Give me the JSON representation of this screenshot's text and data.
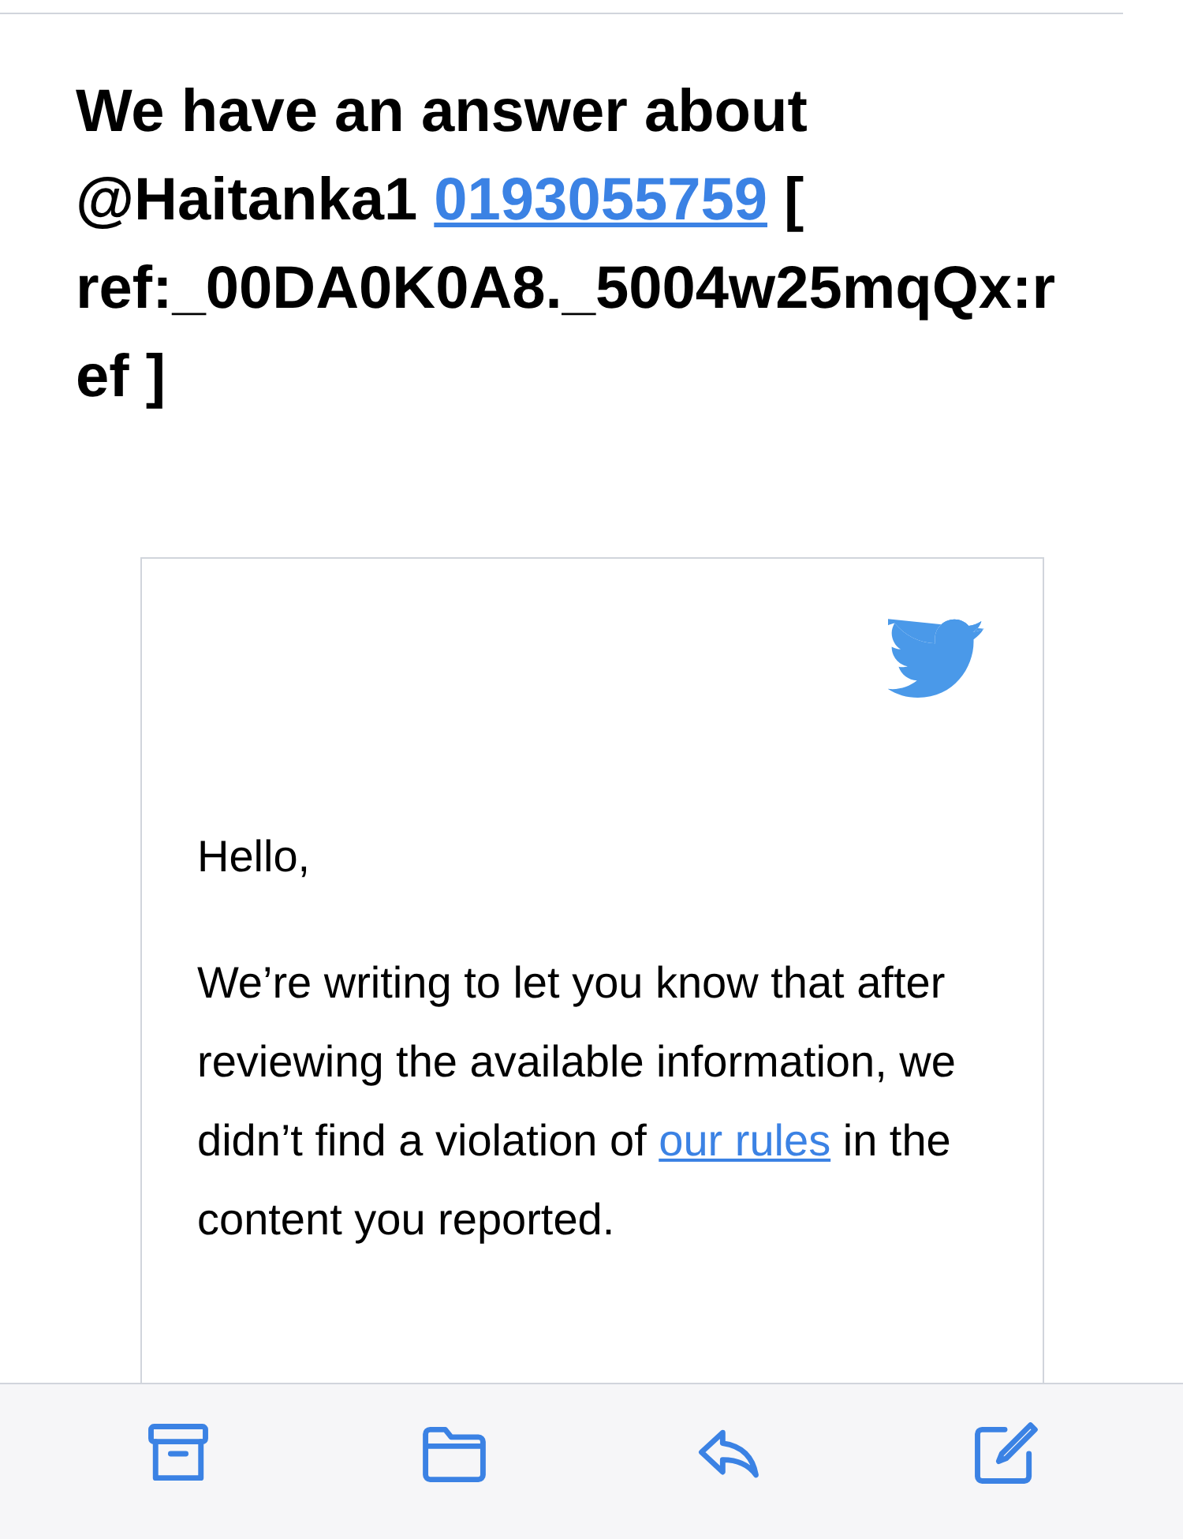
{
  "subject": [
    {
      "kind": "text",
      "text": "We have an answer about @Haitanka1 "
    },
    {
      "kind": "link",
      "text": "0193055759"
    },
    {
      "kind": "text",
      "text": " [ ref:_00DA0K0A8._5004w25mqQx:ref ]"
    }
  ],
  "card": {
    "greeting": "Hello,",
    "paragraph": [
      {
        "kind": "text",
        "text": "We’re writing to let you know that after reviewing the available information, we didn’t find a violation of "
      },
      {
        "kind": "link",
        "text": "our rules"
      },
      {
        "kind": "text",
        "text": " in the content you reported."
      }
    ]
  },
  "toolbar": [
    {
      "kind": "archive"
    },
    {
      "kind": "folder"
    },
    {
      "kind": "reply"
    },
    {
      "kind": "compose"
    }
  ]
}
